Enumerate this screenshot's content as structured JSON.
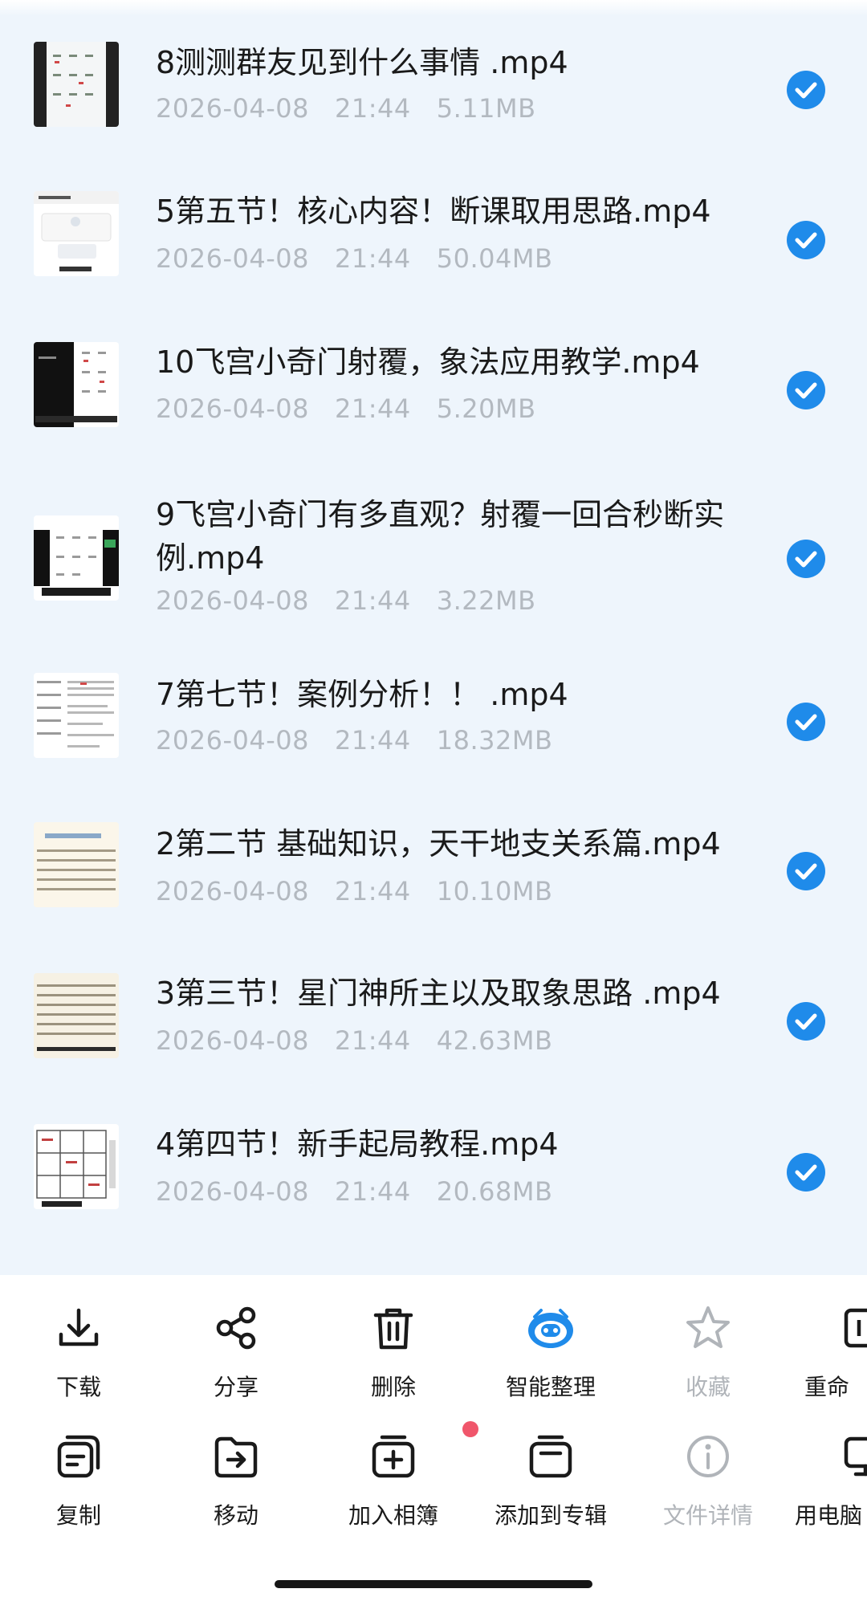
{
  "files": [
    {
      "title": "8测测群友见到什么事情 .mp4",
      "date": "2026-04-08",
      "time": "21:44",
      "size": "5.11MB",
      "checked": true
    },
    {
      "title": "5第五节！核心内容！断课取用思路.mp4",
      "date": "2026-04-08",
      "time": "21:44",
      "size": "50.04MB",
      "checked": true
    },
    {
      "title": "10飞宫小奇门射覆，象法应用教学.mp4",
      "date": "2026-04-08",
      "time": "21:44",
      "size": "5.20MB",
      "checked": true
    },
    {
      "title": "9飞宫小奇门有多直观？射覆一回合秒断实例.mp4",
      "date": "2026-04-08",
      "time": "21:44",
      "size": "3.22MB",
      "checked": true
    },
    {
      "title": "7第七节！案例分析！！ .mp4",
      "date": "2026-04-08",
      "time": "21:44",
      "size": "18.32MB",
      "checked": true
    },
    {
      "title": "2第二节  基础知识，天干地支关系篇.mp4",
      "date": "2026-04-08",
      "time": "21:44",
      "size": "10.10MB",
      "checked": true
    },
    {
      "title": "3第三节！星门神所主以及取象思路 .mp4",
      "date": "2026-04-08",
      "time": "21:44",
      "size": "42.63MB",
      "checked": true
    },
    {
      "title": "4第四节！新手起局教程.mp4",
      "date": "2026-04-08",
      "time": "21:44",
      "size": "20.68MB",
      "checked": true
    }
  ],
  "toolbar": {
    "row1": [
      {
        "label": "下载",
        "icon": "download-icon",
        "enabled": true
      },
      {
        "label": "分享",
        "icon": "share-icon",
        "enabled": true
      },
      {
        "label": "删除",
        "icon": "trash-icon",
        "enabled": true
      },
      {
        "label": "智能整理",
        "icon": "smart-organize-icon",
        "enabled": true
      },
      {
        "label": "收藏",
        "icon": "star-icon",
        "enabled": false
      },
      {
        "label": "重命",
        "icon": "rename-icon",
        "enabled": true
      }
    ],
    "row2": [
      {
        "label": "复制",
        "icon": "copy-icon",
        "enabled": true
      },
      {
        "label": "移动",
        "icon": "move-icon",
        "enabled": true
      },
      {
        "label": "加入相簿",
        "icon": "add-album-icon",
        "enabled": true
      },
      {
        "label": "添加到专辑",
        "icon": "add-collection-icon",
        "enabled": true
      },
      {
        "label": "文件详情",
        "icon": "info-icon",
        "enabled": false
      },
      {
        "label": "用电脑",
        "icon": "computer-icon",
        "enabled": true
      }
    ]
  },
  "colors": {
    "list_background": "#eef5fc",
    "check_blue": "#1f8bea",
    "smart_blue": "#1f8bea",
    "meta_gray": "#b3b9c0",
    "disabled_gray": "#b0b4b9",
    "badge_red": "#f0566b"
  }
}
